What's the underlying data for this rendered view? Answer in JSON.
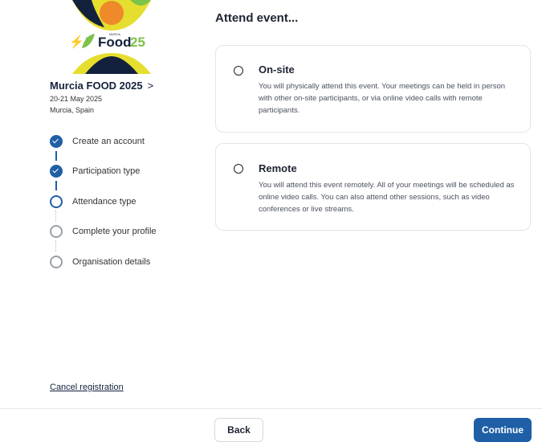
{
  "event": {
    "logo": {
      "small_text": "MURCIA",
      "wordmark": "Food",
      "year": "25",
      "colors": {
        "yellow": "#e6de2e",
        "orange": "#ef8a2a",
        "green": "#7dc24b",
        "navy": "#14213d"
      }
    },
    "title": "Murcia FOOD 2025",
    "chevron": ">",
    "date": "20-21 May 2025",
    "location": "Murcia, Spain"
  },
  "steps": [
    {
      "label": "Create an account",
      "state": "done"
    },
    {
      "label": "Participation type",
      "state": "done"
    },
    {
      "label": "Attendance type",
      "state": "active"
    },
    {
      "label": "Complete your profile",
      "state": "todo"
    },
    {
      "label": "Organisation details",
      "state": "todo"
    }
  ],
  "cancel_label": "Cancel registration",
  "main": {
    "heading": "Attend event...",
    "options": [
      {
        "title": "On-site",
        "selected": false,
        "description": "You will physically attend this event. Your meetings can be held in person with other on-site participants, or via online video calls with remote participants."
      },
      {
        "title": "Remote",
        "selected": false,
        "description": "You will attend this event remotely. All of your meetings will be scheduled as online video calls. You can also attend other sessions, such as video conferences or live streams."
      }
    ]
  },
  "footer": {
    "back_label": "Back",
    "continue_label": "Continue"
  },
  "colors": {
    "accent": "#1f5fa6",
    "text": "#1e2433",
    "muted": "#9aa0a8"
  }
}
